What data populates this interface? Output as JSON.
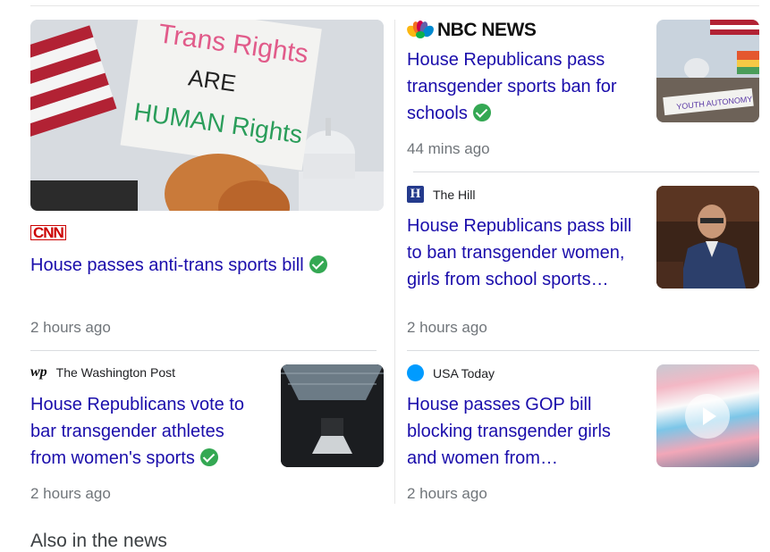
{
  "main": {
    "source": "CNN",
    "headline": "House passes anti-trans sports bill",
    "time": "2 hours ago",
    "image_sign": {
      "line1": "Trans Rights",
      "line2": "ARE",
      "line3": "HUMAN Rights"
    }
  },
  "nbc": {
    "source": "NBC NEWS",
    "headline": "House Republicans pass transgender sports ban for schools",
    "time": "44 mins ago",
    "image_banner": "YOUTH AUTONOMY"
  },
  "hill": {
    "source": "The Hill",
    "headline": "House Republicans pass bill to ban transgender women, girls from school sports…",
    "time": "2 hours ago"
  },
  "wapo": {
    "source": "The Washington Post",
    "headline": "House Republicans vote to bar transgender athletes from women's sports",
    "time": "2 hours ago"
  },
  "usa": {
    "source": "USA Today",
    "headline": "House passes GOP bill blocking transgender girls and women from…",
    "time": "2 hours ago"
  },
  "section_heading": "Also in the news",
  "colors": {
    "link": "#1a0dab",
    "time": "#70757a",
    "verified": "#34a853",
    "cnn": "#cc0000"
  }
}
